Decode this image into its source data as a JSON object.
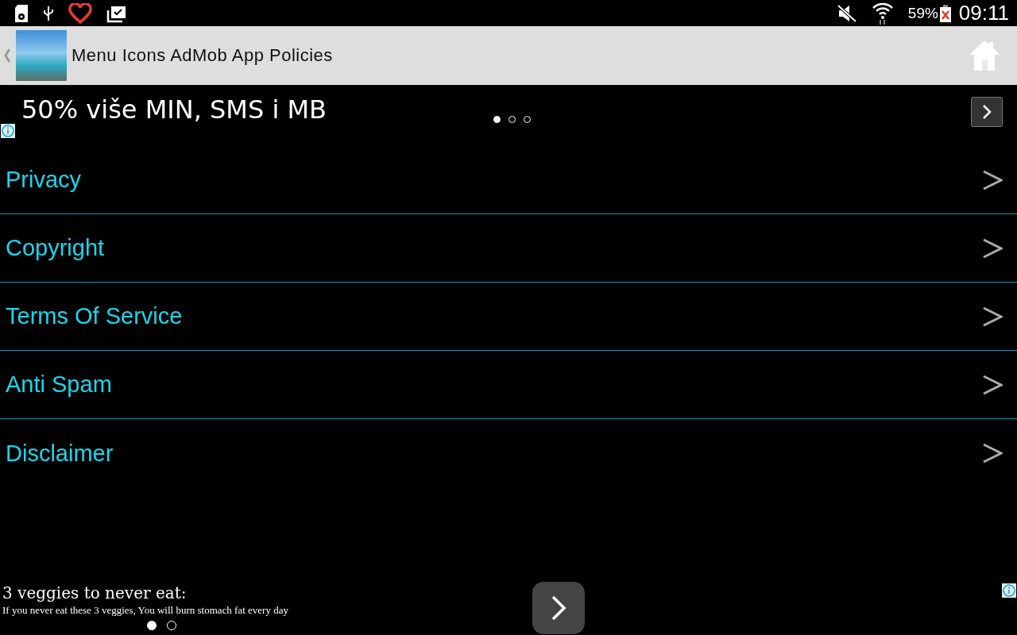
{
  "status_bar": {
    "battery": "59%",
    "time": "09:11"
  },
  "action_bar": {
    "title": "Menu Icons AdMob App Policies"
  },
  "top_ad": {
    "headline": "50% više MIN, SMS i MB",
    "dots": [
      {
        "selected": true
      },
      {
        "selected": false
      },
      {
        "selected": false
      }
    ]
  },
  "menu": [
    {
      "label": "Privacy"
    },
    {
      "label": "Copyright"
    },
    {
      "label": "Terms Of Service"
    },
    {
      "label": "Anti Spam"
    },
    {
      "label": "Disclaimer"
    }
  ],
  "bottom_ad": {
    "headline": "3 veggies to never eat:",
    "body": "If you never eat these 3 veggies, You will burn stomach fat every day",
    "dots": [
      {
        "selected": true
      },
      {
        "selected": false
      }
    ]
  }
}
